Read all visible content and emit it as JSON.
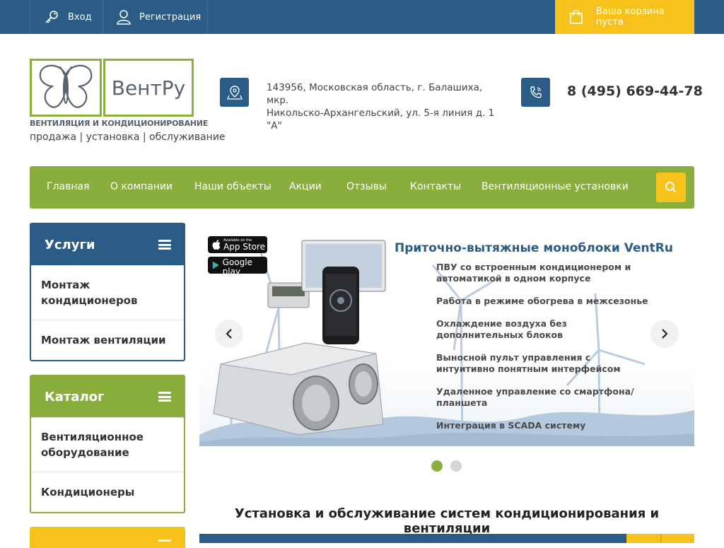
{
  "topbar": {
    "login_label": "Вход",
    "register_label": "Регистрация",
    "cart_label": "Ваша корзина пуста"
  },
  "header": {
    "logo_text": "ВентРу",
    "logo_subtitle": "ВЕНТИЛЯЦИЯ И КОНДИЦИОНИРОВАНИЕ",
    "tagline": "продажа | установка | обслуживание",
    "address_line1": "143956, Московская область, г. Балашиха, мкр.",
    "address_line2": "Никольско-Архангельский, ул. 5-я линия д. 1 \"А\"",
    "phone": "8 (495) 669-44-78"
  },
  "nav": {
    "items": [
      {
        "label": "Главная"
      },
      {
        "label": "О компании"
      },
      {
        "label": "Наши объекты"
      },
      {
        "label": "Акции"
      },
      {
        "label": "Отзывы"
      },
      {
        "label": "Контакты"
      },
      {
        "label": "Вентиляционные установки"
      }
    ]
  },
  "sidebar": {
    "services": {
      "title": "Услуги",
      "items": [
        {
          "label": "Монтаж кондиционеров"
        },
        {
          "label": "Монтаж вентиляции"
        }
      ]
    },
    "catalog": {
      "title": "Каталог",
      "items": [
        {
          "label": "Вентиляционное оборудование"
        },
        {
          "label": "Кондиционеры"
        }
      ]
    }
  },
  "slider": {
    "title": "Приточно-вытяжные моноблоки VentRu",
    "features": [
      "ПВУ со встроенным кондиционером и автоматикой в одном корпусе",
      "Работа в режиме обогрева в межсезонье",
      "Охлаждение воздуха без дополнительных блоков",
      "Выносной пульт управления с интуитивно понятным интерфейсом",
      "Удаленное управление со смартфона/ планшета",
      "Интеграция в SCADA систему"
    ],
    "appstore_small": "Available on the",
    "appstore_big": "App Store",
    "googleplay_small": "Get it on",
    "googleplay_big": "Google play",
    "active_slide": 1,
    "slide_count": 2
  },
  "section": {
    "title": "Установка и обслуживание систем кондиционирования и вентиляции"
  },
  "colors": {
    "blue": "#2b5b87",
    "green": "#8aae3c",
    "yellow": "#f8c21c"
  }
}
